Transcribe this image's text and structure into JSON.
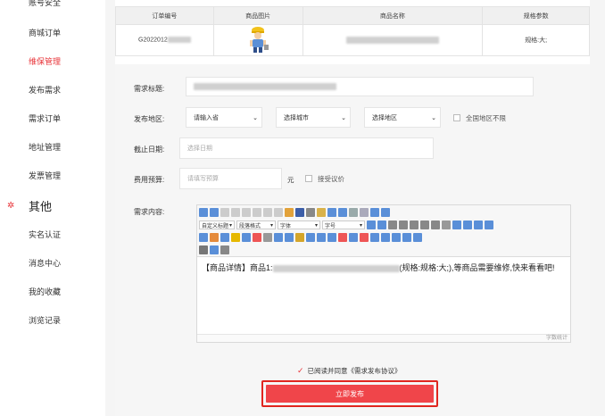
{
  "sidebar": {
    "items_top": [
      {
        "label": "账号安全"
      },
      {
        "label": "商城订单"
      },
      {
        "label": "维保管理"
      },
      {
        "label": "发布需求"
      },
      {
        "label": "需求订单"
      },
      {
        "label": "地址管理"
      },
      {
        "label": "发票管理"
      }
    ],
    "group": {
      "title": "其他"
    },
    "items_other": [
      {
        "label": "实名认证"
      },
      {
        "label": "消息中心"
      },
      {
        "label": "我的收藏"
      },
      {
        "label": "浏览记录"
      }
    ]
  },
  "order_table": {
    "headers": [
      "订单编号",
      "商品图片",
      "商品名称",
      "规格参数"
    ],
    "row": {
      "order_no": "G2022012",
      "spec": "规格:大;"
    }
  },
  "form": {
    "title_label": "需求标题:",
    "region_label": "发布地区:",
    "province_select": "请输入省",
    "city_select": "选择城市",
    "district_select": "选择地区",
    "nationwide_label": "全国地区不限",
    "deadline_label": "截止日期:",
    "deadline_placeholder": "选择日期",
    "budget_label": "费用预算:",
    "budget_placeholder": "请填写预算",
    "budget_unit": "元",
    "negotiable_label": "接受议价",
    "content_label": "需求内容:"
  },
  "editor": {
    "select_heading": "自定义标题",
    "select_paragraph": "段落格式",
    "select_font": "字体",
    "select_size": "字号",
    "content_prefix": "【商品详情】商品1:",
    "content_suffix": "(规格:规格:大;),等商品需要维修,快来看看吧!",
    "word_count_label": "字数统计"
  },
  "agree": {
    "text": "已阅读并同意《需求发布协议》"
  },
  "submit": {
    "label": "立即发布"
  }
}
